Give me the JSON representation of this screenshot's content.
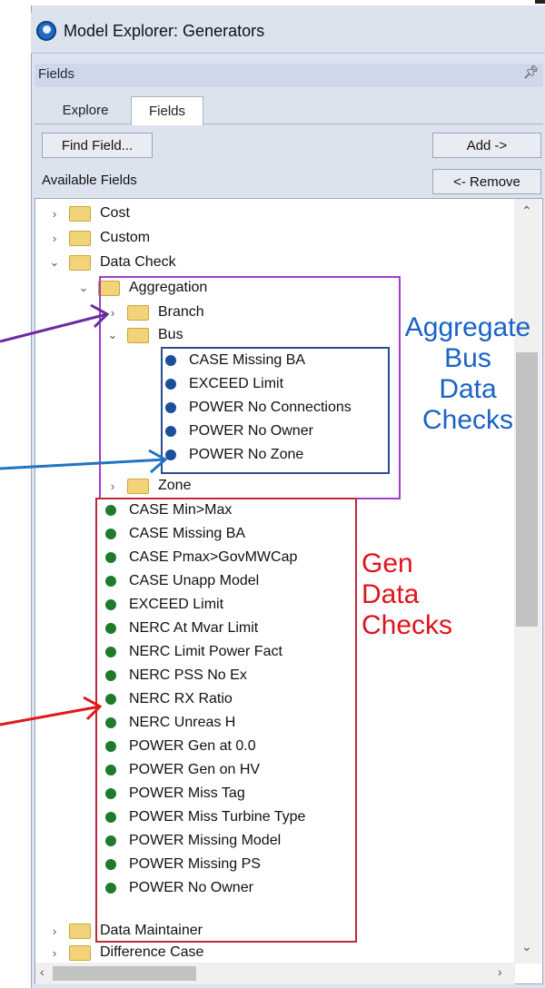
{
  "window": {
    "title": "Model Explorer: Generators"
  },
  "pane": {
    "title": "Fields",
    "pin_icon": "pin-icon"
  },
  "tabs": [
    {
      "label": "Explore"
    },
    {
      "label": "Fields",
      "selected": true
    }
  ],
  "buttons": {
    "find_field": "Find Field...",
    "add": "Add ->",
    "remove": "<- Remove"
  },
  "available_fields_label": "Available Fields",
  "tree": {
    "cost": "Cost",
    "custom": "Custom",
    "data_check": "Data Check",
    "aggregation": "Aggregation",
    "branch": "Branch",
    "bus": "Bus",
    "bus_items": [
      "CASE Missing BA",
      "EXCEED Limit",
      "POWER No Connections",
      "POWER No Owner",
      "POWER No Zone"
    ],
    "zone": "Zone",
    "gen_items": [
      "CASE Min>Max",
      "CASE Missing BA",
      "CASE Pmax>GovMWCap",
      "CASE Unapp Model",
      "EXCEED Limit",
      "NERC At Mvar Limit",
      "NERC Limit Power Fact",
      "NERC PSS No Ex",
      "NERC RX Ratio",
      "NERC Unreas H",
      "POWER Gen at 0.0",
      "POWER Gen on HV",
      "POWER Miss Tag",
      "POWER Miss Turbine Type",
      "POWER Missing Model",
      "POWER Missing PS",
      "POWER No Owner"
    ],
    "data_maintainer": "Data Maintainer",
    "difference_case": "Difference Case"
  },
  "annotations": {
    "aggregate": [
      "Aggregate",
      "Bus",
      "Data",
      "Checks"
    ],
    "gen": [
      "Gen",
      "Data",
      "Checks"
    ]
  },
  "colors": {
    "annotation_blue": "#1a62c8",
    "annotation_red": "#e0141c",
    "purple_box": "#a23dcc",
    "red_box": "#c0283a",
    "arrow_purple": "#6a2b9e",
    "arrow_blue": "#1f74c4",
    "arrow_red": "#e01818"
  }
}
